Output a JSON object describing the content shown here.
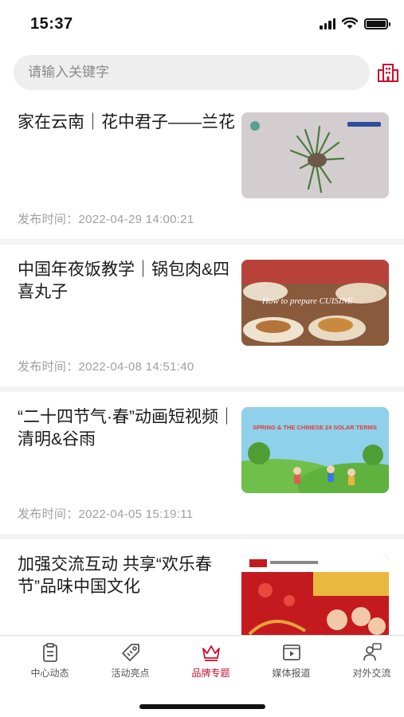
{
  "status_bar": {
    "time": "15:37"
  },
  "search": {
    "placeholder": "请输入关键字",
    "value": ""
  },
  "accent_color": "#c8102e",
  "news": [
    {
      "title": "家在云南｜花中君子——兰花",
      "time_label": "发布时间：2022-04-29 14:00:21",
      "image": "orchid-photo"
    },
    {
      "title": "中国年夜饭教学｜锅包肉&四喜丸子",
      "time_label": "发布时间：2022-04-08 14:51:40",
      "image": "chinese-cuisine-photo",
      "image_text": "How to prepare CUISINE"
    },
    {
      "title": "“二十四节气·春”动画短视频｜清明&谷雨",
      "time_label": "发布时间：2022-04-05 15:19:11",
      "image": "solar-terms-illustration",
      "image_text": "SPRING & THE CHINESE 24 SOLAR TERMS"
    },
    {
      "title": "加强交流互动 共享“欢乐春节”品味中国文化",
      "time_label": "",
      "image": "spring-festival-poster"
    }
  ],
  "tabs": [
    {
      "label": "中心动态",
      "icon": "clipboard-icon"
    },
    {
      "label": "活动亮点",
      "icon": "tag-icon"
    },
    {
      "label": "品牌专题",
      "icon": "crown-icon",
      "active": true
    },
    {
      "label": "媒体报道",
      "icon": "video-icon"
    },
    {
      "label": "对外交流",
      "icon": "chat-person-icon"
    }
  ]
}
